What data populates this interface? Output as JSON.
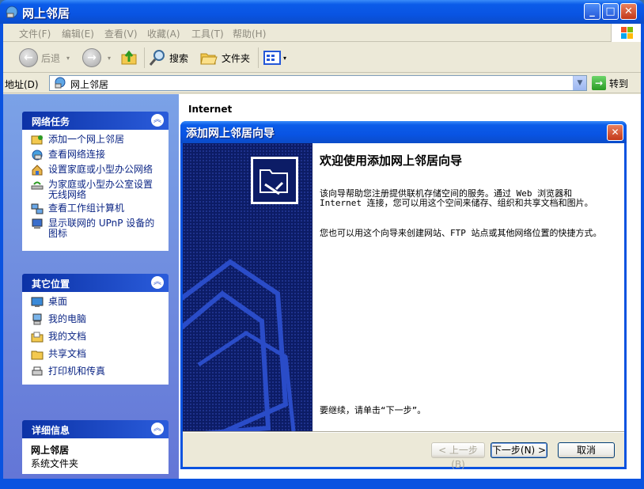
{
  "window": {
    "title": "网上邻居"
  },
  "menu": [
    "文件(F)",
    "编辑(E)",
    "查看(V)",
    "收藏(A)",
    "工具(T)",
    "帮助(H)"
  ],
  "toolbar": {
    "back": "后退",
    "search": "搜索",
    "folders": "文件夹"
  },
  "address": {
    "label": "地址(D)",
    "value": "网上邻居",
    "go": "转到"
  },
  "tasks": {
    "title": "网络任务",
    "items": [
      "添加一个网上邻居",
      "查看网络连接",
      "设置家庭或小型办公网络",
      "为家庭或小型办公室设置无线网络",
      "查看工作组计算机",
      "显示联网的 UPnP 设备的图标"
    ]
  },
  "places": {
    "title": "其它位置",
    "items": [
      "桌面",
      "我的电脑",
      "我的文档",
      "共享文档",
      "打印机和传真"
    ]
  },
  "details": {
    "title": "详细信息",
    "name": "网上邻居",
    "type": "系统文件夹"
  },
  "content": {
    "column_header": "Internet"
  },
  "wizard": {
    "title": "添加网上邻居向导",
    "heading": "欢迎使用添加网上邻居向导",
    "para1": "该向导帮助您注册提供联机存储空间的服务。通过 Web 浏览器和 Internet 连接，您可以用这个空间来储存、组织和共享文档和图片。",
    "para2": "您也可以用这个向导来创建网站、FTP 站点或其他网络位置的快捷方式。",
    "para3": "要继续，请单击“下一步”。",
    "back": "< 上一步(B)",
    "next": "下一步(N) >",
    "cancel": "取消"
  }
}
